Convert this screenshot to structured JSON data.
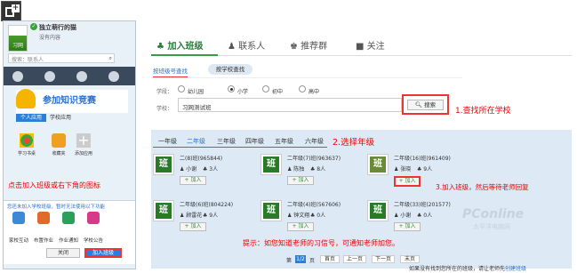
{
  "user": {
    "name": "独立萌行的猫",
    "subtitle": "没有内容",
    "avatar_text": "习网"
  },
  "search": {
    "placeholder": "搜索：联系人"
  },
  "banner": {
    "text": "参加知识竞赛",
    "tab_personal": "个人应用",
    "tab_school": "学校应用"
  },
  "apps": [
    {
      "label": "学习书桌"
    },
    {
      "label": "收藏夹"
    },
    {
      "label": "添加应用"
    }
  ],
  "hint_left": "点击加入班级或右下角的图标",
  "lower": {
    "title": "您还未加入学校班级，暂时无法使用以下功能",
    "apps": [
      {
        "label": "家校互动"
      },
      {
        "label": "布置作业"
      },
      {
        "label": "作业通知"
      },
      {
        "label": "学校公告"
      }
    ],
    "close_label": "关闭",
    "join_label": "加入班级"
  },
  "main_tabs": [
    {
      "label": "加入班级",
      "icon": "people-icon"
    },
    {
      "label": "联系人",
      "icon": "contacts-icon"
    },
    {
      "label": "推荐群",
      "icon": "group-icon"
    },
    {
      "label": "关注",
      "icon": "follow-icon"
    }
  ],
  "search_tabs": {
    "by_number": "按班级号查找",
    "by_school": "按学校查找"
  },
  "school_level": {
    "label": "学段：",
    "options": [
      "幼儿园",
      "小学",
      "初中",
      "高中"
    ],
    "selected": "小学"
  },
  "school": {
    "label": "学校：",
    "value": "习网测试班"
  },
  "search_button": "搜索",
  "step1": "1.查找所在学校",
  "grades": [
    "一年级",
    "二年级",
    "三年级",
    "四年级",
    "五年级",
    "六年级"
  ],
  "grade_selected": "二年级",
  "step2": "2.选择年级",
  "classes": [
    {
      "name": "二(8)班(965844)",
      "teacher": "小谢",
      "count": "3人",
      "icon_char": "班"
    },
    {
      "name": "二年级(7)班(963637)",
      "teacher": "陈独",
      "count": "8人",
      "icon_char": "班"
    },
    {
      "name": "二年级(16)班(961409)",
      "teacher": "张晓",
      "count": "9人",
      "icon_char": "班"
    },
    {
      "name": "二年级(6)班(804224)",
      "teacher": "顾雷花",
      "count": "9人",
      "icon_char": "班"
    },
    {
      "name": "二年级(4)班(567606)",
      "teacher": "钟文翔",
      "count": "0人",
      "icon_char": "班"
    },
    {
      "name": "二年级(33)班(201577)",
      "teacher": "小谢",
      "count": "0人",
      "icon_char": "班"
    }
  ],
  "add_label": "加入",
  "step3": "3.加入班级，然后等待老师回复",
  "tip": "提示：如您知道老师的习信号，可通知老师加您。",
  "pager": {
    "prefix": "第",
    "current": "1/2",
    "suffix": "页",
    "first": "首页",
    "prev": "上一页",
    "next": "下一页",
    "last": "末页"
  },
  "footer": {
    "text": "如果没有找到您所在的班级，请让老师先",
    "link": "创建班级"
  },
  "watermark": {
    "line1": "PConline",
    "line2": "太平洋电脑网"
  }
}
